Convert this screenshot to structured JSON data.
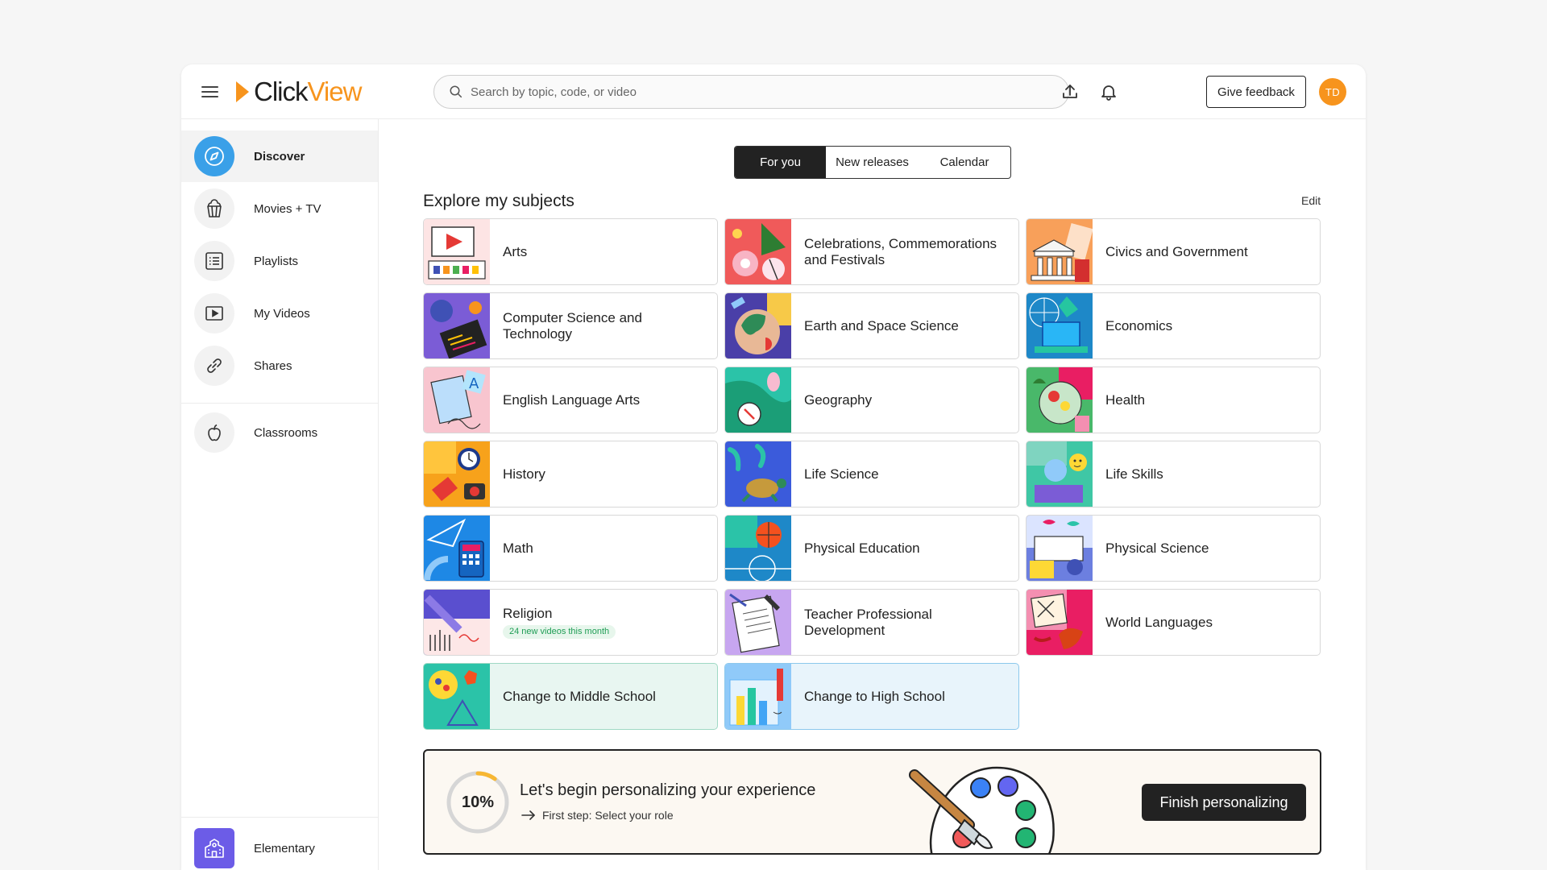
{
  "header": {
    "logo": {
      "part1": "Click",
      "part2": "View"
    },
    "search_placeholder": "Search by topic, code, or video",
    "feedback_label": "Give feedback",
    "avatar_initials": "TD"
  },
  "sidebar": {
    "items": [
      {
        "label": "Discover",
        "icon": "compass-icon",
        "active": true
      },
      {
        "label": "Movies + TV",
        "icon": "popcorn-icon"
      },
      {
        "label": "Playlists",
        "icon": "list-icon"
      },
      {
        "label": "My Videos",
        "icon": "play-icon"
      },
      {
        "label": "Shares",
        "icon": "link-icon"
      },
      {
        "label": "Classrooms",
        "icon": "apple-icon"
      }
    ],
    "school": {
      "label": "Elementary",
      "icon": "school-icon"
    }
  },
  "tabs": [
    {
      "label": "For you",
      "active": true
    },
    {
      "label": "New releases"
    },
    {
      "label": "Calendar"
    }
  ],
  "subjects": {
    "title": "Explore my subjects",
    "edit_label": "Edit",
    "cards": [
      {
        "label": "Arts"
      },
      {
        "label": "Celebrations, Commemorations and Festivals"
      },
      {
        "label": "Civics and Government"
      },
      {
        "label": "Computer Science and Technology"
      },
      {
        "label": "Earth and Space Science"
      },
      {
        "label": "Economics"
      },
      {
        "label": "English Language Arts"
      },
      {
        "label": "Geography"
      },
      {
        "label": "Health"
      },
      {
        "label": "History"
      },
      {
        "label": "Life Science"
      },
      {
        "label": "Life Skills"
      },
      {
        "label": "Math"
      },
      {
        "label": "Physical Education"
      },
      {
        "label": "Physical Science"
      },
      {
        "label": "Religion",
        "badge": "24 new videos this month"
      },
      {
        "label": "Teacher Professional Development"
      },
      {
        "label": "World Languages"
      },
      {
        "label": "Change to Middle School"
      },
      {
        "label": "Change to High School"
      }
    ]
  },
  "banner": {
    "progress_text": "10%",
    "progress_value": 0.1,
    "title": "Let's begin personalizing your experience",
    "step": "First step: Select your role",
    "button_label": "Finish personalizing"
  },
  "colors": {
    "brand_orange": "#f7941d",
    "active_blue": "#3aa0e8",
    "dark": "#222222"
  }
}
